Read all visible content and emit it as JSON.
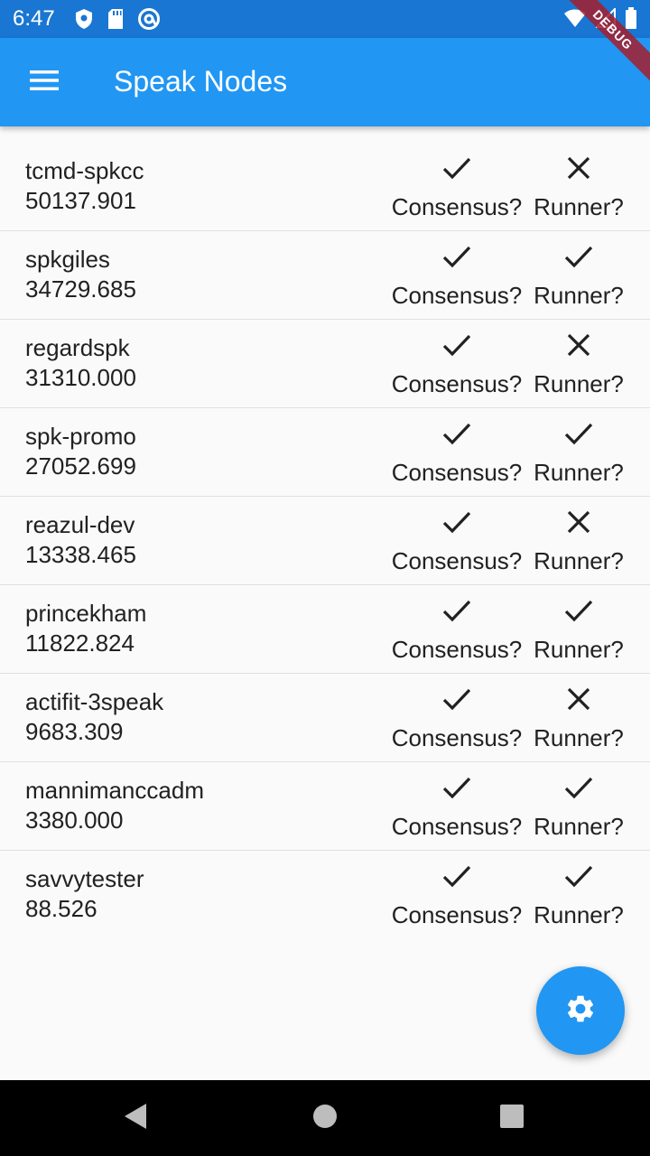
{
  "status_bar": {
    "time": "6:47",
    "left_icons": [
      "shield-icon",
      "sd-card-icon",
      "at-icon"
    ],
    "right_icons": [
      "wifi-icon",
      "signal-icon",
      "battery-icon"
    ]
  },
  "debug_banner": "DEBUG",
  "app_bar": {
    "title": "Speak Nodes",
    "menu_icon": "menu-icon"
  },
  "labels": {
    "consensus": "Consensus?",
    "runner": "Runner?"
  },
  "nodes": [
    {
      "name": "tcmd-spkcc",
      "value": "50137.901",
      "consensus": true,
      "runner": false
    },
    {
      "name": "spkgiles",
      "value": "34729.685",
      "consensus": true,
      "runner": true
    },
    {
      "name": "regardspk",
      "value": "31310.000",
      "consensus": true,
      "runner": false
    },
    {
      "name": "spk-promo",
      "value": "27052.699",
      "consensus": true,
      "runner": true
    },
    {
      "name": "reazul-dev",
      "value": "13338.465",
      "consensus": true,
      "runner": false
    },
    {
      "name": "princekham",
      "value": "11822.824",
      "consensus": true,
      "runner": true
    },
    {
      "name": "actifit-3speak",
      "value": "9683.309",
      "consensus": true,
      "runner": false
    },
    {
      "name": "mannimanccadm",
      "value": "3380.000",
      "consensus": true,
      "runner": true
    },
    {
      "name": "savvytester",
      "value": "88.526",
      "consensus": true,
      "runner": true
    }
  ],
  "fab": {
    "icon": "gear-icon"
  },
  "nav_bar": {
    "buttons": [
      "back-icon",
      "home-icon",
      "recents-icon"
    ]
  },
  "colors": {
    "primary": "#2196f3",
    "primary_dark": "#1976d2",
    "background": "#fafafa",
    "text": "#212121",
    "debug": "#a51e2d"
  }
}
